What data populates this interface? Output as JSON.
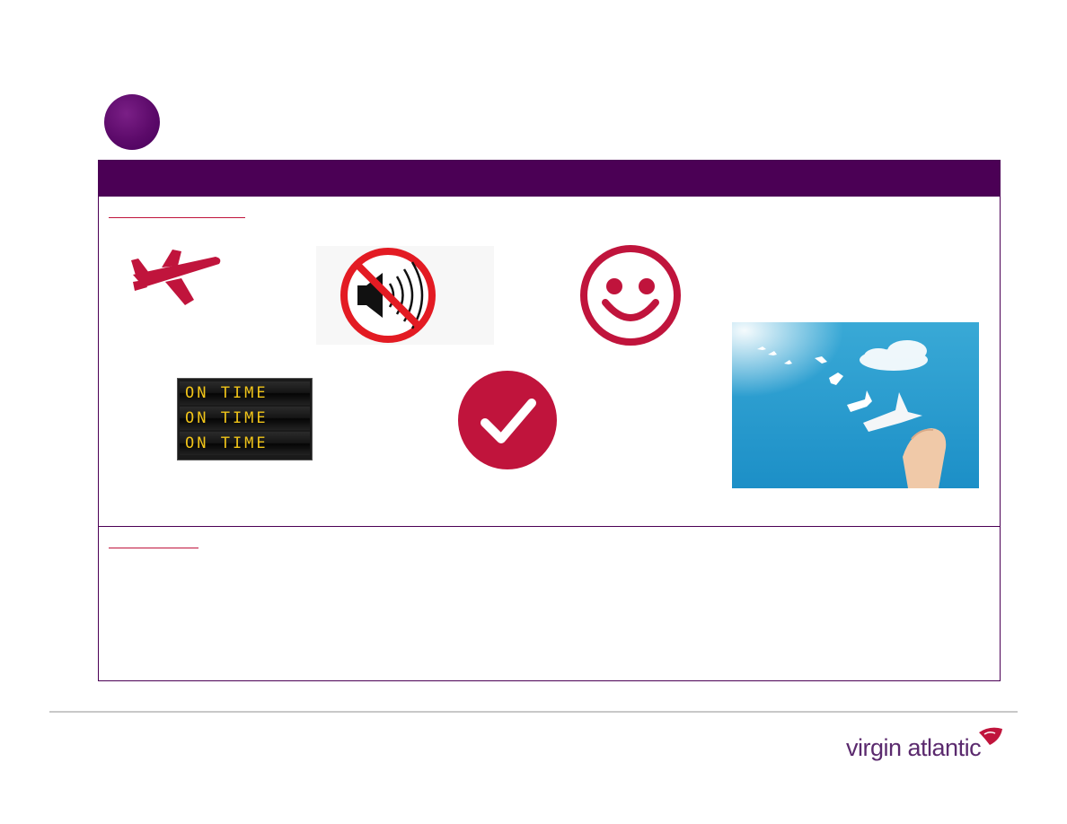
{
  "header": {
    "badge_color": "#5c0a6a",
    "bar_color": "#4b0055"
  },
  "icons": {
    "plane": "airplane-icon",
    "no_sound": "mute-speaker-icon",
    "smiley": "smiley-face-icon",
    "check": "checkmark-icon",
    "accent_color": "#c0143c"
  },
  "departure_board": {
    "rows": [
      "ON TIME",
      "ON TIME",
      "ON TIME"
    ],
    "text_color": "#f0c419"
  },
  "logo": {
    "text": "virgin atlantic",
    "badge_text": "Virgin",
    "brand_color": "#c0143c"
  }
}
